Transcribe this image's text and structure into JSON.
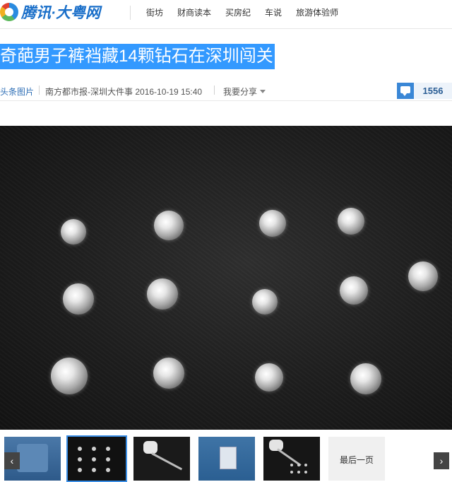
{
  "site": {
    "logo_text": "腾讯·大粤网",
    "nav": [
      "街坊",
      "财商读本",
      "买房纪",
      "车说",
      "旅游体验师"
    ]
  },
  "article": {
    "headline": "奇葩男子裤裆藏14颗钻石在深圳闯关",
    "category": "头条图片",
    "source": "南方都市报-深圳大件事",
    "datetime": "2016-10-19 15:40",
    "share_label": "我要分享",
    "comment_count": "1556"
  },
  "gallery": {
    "prev_icon": "‹",
    "next_icon": "›",
    "last_page_label": "最后一页",
    "selected_index": 1
  },
  "colors": {
    "headline_highlight": "#3399ff",
    "link_blue": "#2f6fb6",
    "comment_blue": "#3a87d6",
    "thumb_border": "#3a8ee6"
  }
}
